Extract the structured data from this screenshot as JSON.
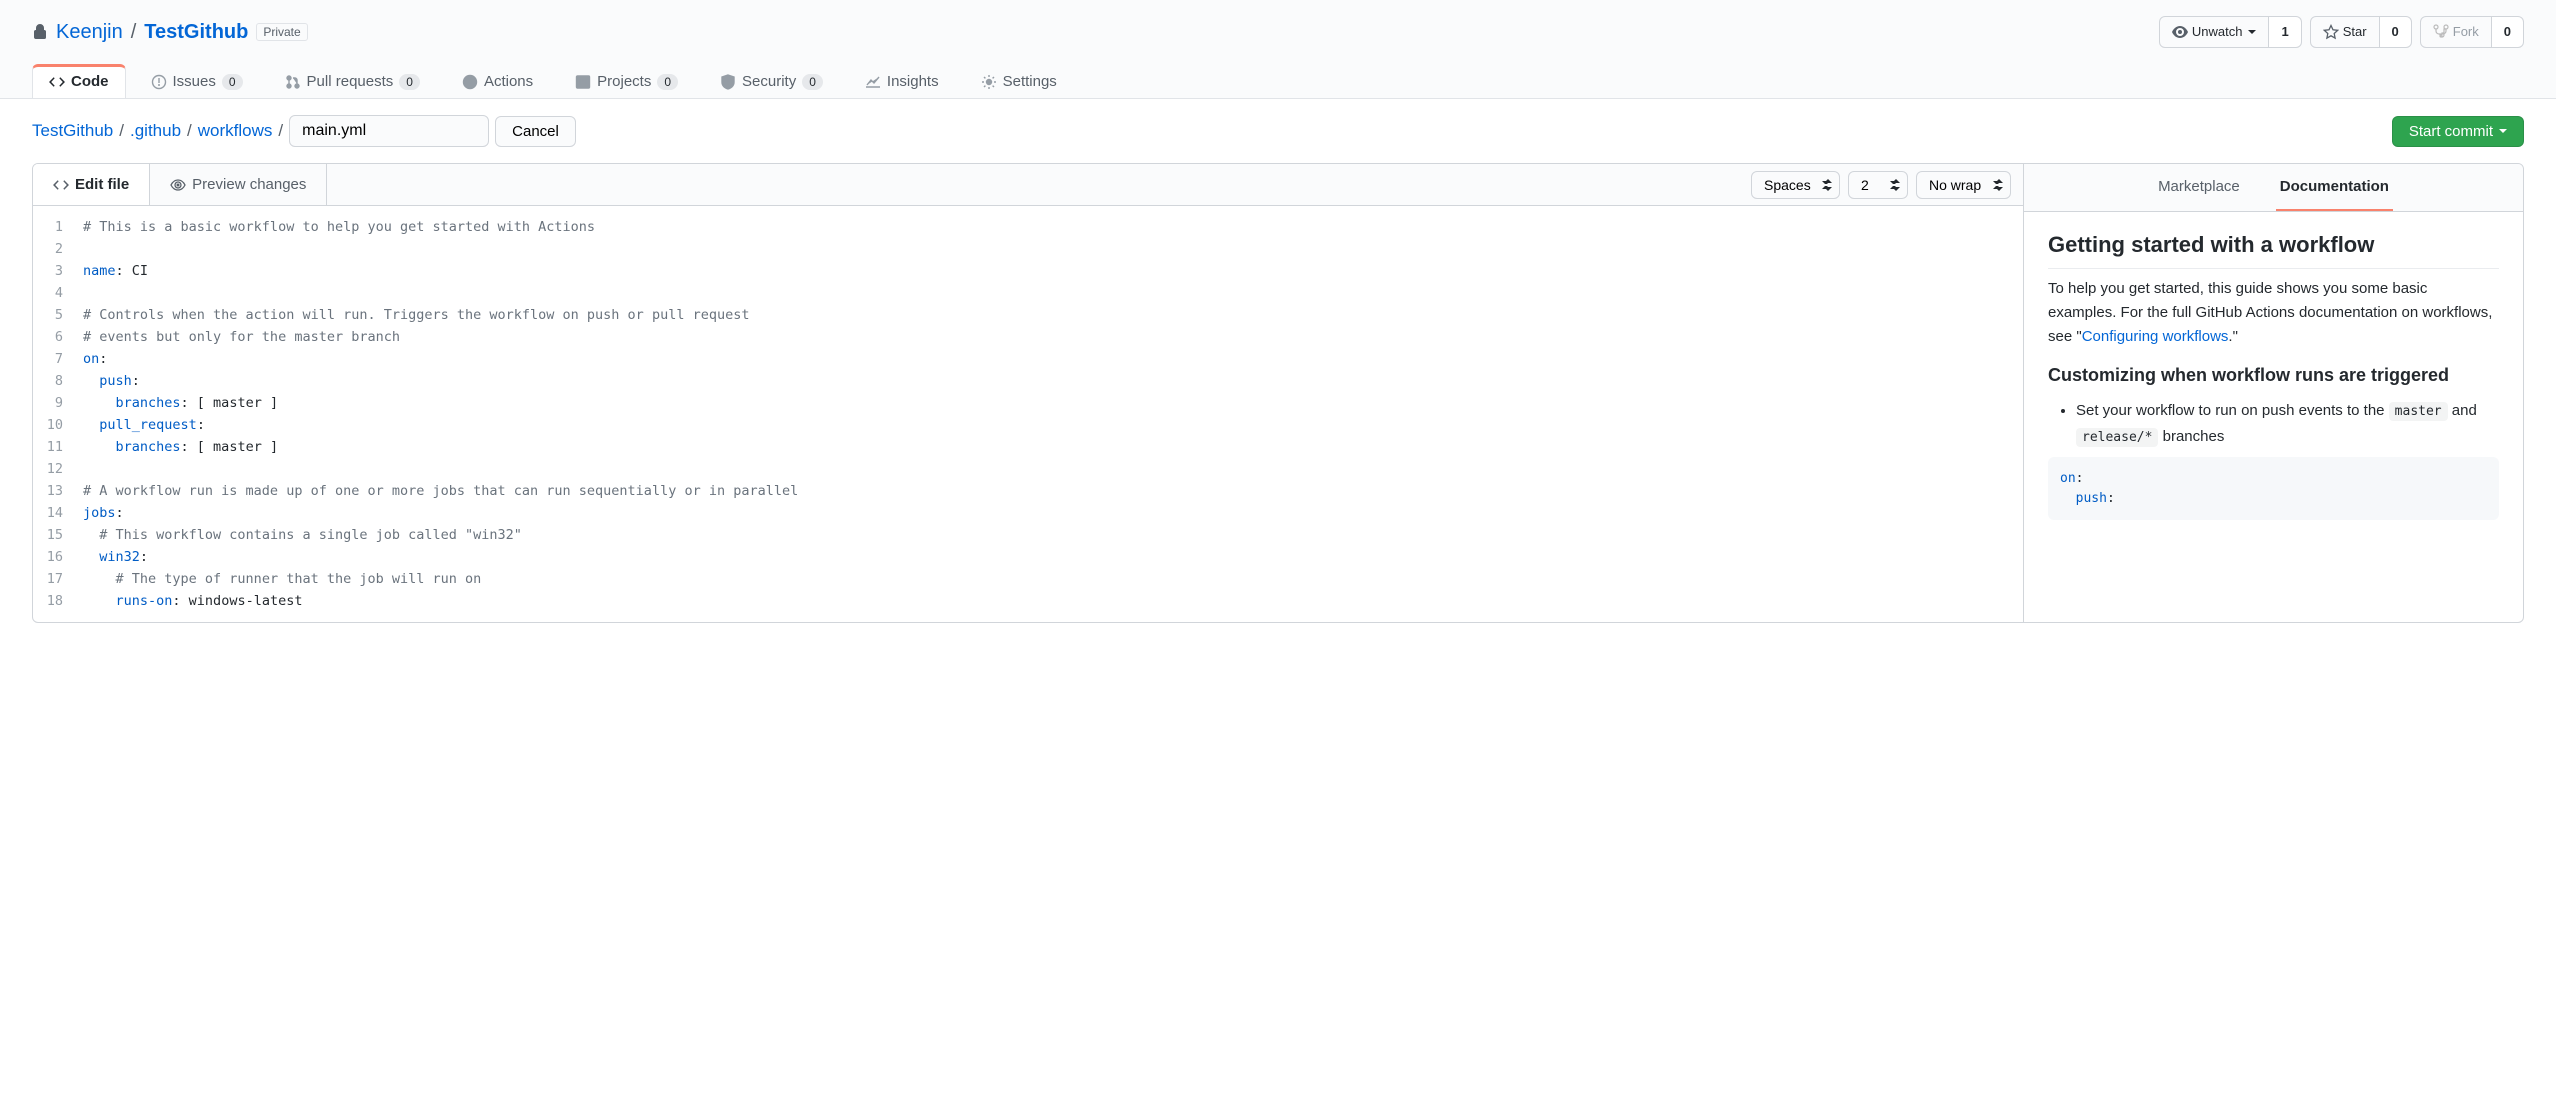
{
  "repo": {
    "owner": "Keenjin",
    "name": "TestGithub",
    "visibility": "Private"
  },
  "repo_actions": {
    "unwatch": {
      "label": "Unwatch",
      "count": "1"
    },
    "star": {
      "label": "Star",
      "count": "0"
    },
    "fork": {
      "label": "Fork",
      "count": "0"
    }
  },
  "repo_nav": {
    "code": "Code",
    "issues": {
      "label": "Issues",
      "count": "0"
    },
    "pull_requests": {
      "label": "Pull requests",
      "count": "0"
    },
    "actions": "Actions",
    "projects": {
      "label": "Projects",
      "count": "0"
    },
    "security": {
      "label": "Security",
      "count": "0"
    },
    "insights": "Insights",
    "settings": "Settings"
  },
  "breadcrumb": {
    "root": "TestGithub",
    "seg1": ".github",
    "seg2": "workflows",
    "filename": "main.yml",
    "cancel": "Cancel",
    "start_commit": "Start commit"
  },
  "editor": {
    "tab_edit": "Edit file",
    "tab_preview": "Preview changes",
    "indent_mode": "Spaces",
    "indent_size": "2",
    "wrap_mode": "No wrap",
    "lines": [
      {
        "n": "1",
        "t": "comment",
        "text": "# This is a basic workflow to help you get started with Actions"
      },
      {
        "n": "2",
        "t": "blank",
        "text": ""
      },
      {
        "n": "3",
        "t": "kv",
        "key": "name",
        "val": ": CI"
      },
      {
        "n": "4",
        "t": "blank",
        "text": ""
      },
      {
        "n": "5",
        "t": "comment",
        "text": "# Controls when the action will run. Triggers the workflow on push or pull request"
      },
      {
        "n": "6",
        "t": "comment",
        "text": "# events but only for the master branch"
      },
      {
        "n": "7",
        "t": "kv",
        "key": "on",
        "val": ":"
      },
      {
        "n": "8",
        "t": "kv",
        "indent": "  ",
        "key": "push",
        "val": ":"
      },
      {
        "n": "9",
        "t": "kv",
        "indent": "    ",
        "key": "branches",
        "val": ": [ master ]"
      },
      {
        "n": "10",
        "t": "kv",
        "indent": "  ",
        "key": "pull_request",
        "val": ":"
      },
      {
        "n": "11",
        "t": "kv",
        "indent": "    ",
        "key": "branches",
        "val": ": [ master ]"
      },
      {
        "n": "12",
        "t": "blank",
        "text": ""
      },
      {
        "n": "13",
        "t": "comment",
        "text": "# A workflow run is made up of one or more jobs that can run sequentially or in parallel"
      },
      {
        "n": "14",
        "t": "kv",
        "key": "jobs",
        "val": ":"
      },
      {
        "n": "15",
        "t": "comment",
        "indent": "  ",
        "text": "# This workflow contains a single job called \"win32\""
      },
      {
        "n": "16",
        "t": "kv",
        "indent": "  ",
        "key": "win32",
        "val": ":"
      },
      {
        "n": "17",
        "t": "comment",
        "indent": "    ",
        "text": "# The type of runner that the job will run on"
      },
      {
        "n": "18",
        "t": "kv",
        "indent": "    ",
        "key": "runs-on",
        "val": ": windows-latest"
      }
    ]
  },
  "sidebar": {
    "tab_marketplace": "Marketplace",
    "tab_documentation": "Documentation",
    "heading": "Getting started with a workflow",
    "intro_1": "To help you get started, this guide shows you some basic examples. For the full GitHub Actions documentation on workflows, see \"",
    "intro_link": "Configuring workflows",
    "intro_2": ".\"",
    "subheading": "Customizing when workflow runs are triggered",
    "bullet_1a": "Set your workflow to run on push events to the ",
    "bullet_1_code1": "master",
    "bullet_1b": " and ",
    "bullet_1_code2": "release/*",
    "bullet_1c": " branches",
    "snippet_on": "on",
    "snippet_push": "push"
  }
}
